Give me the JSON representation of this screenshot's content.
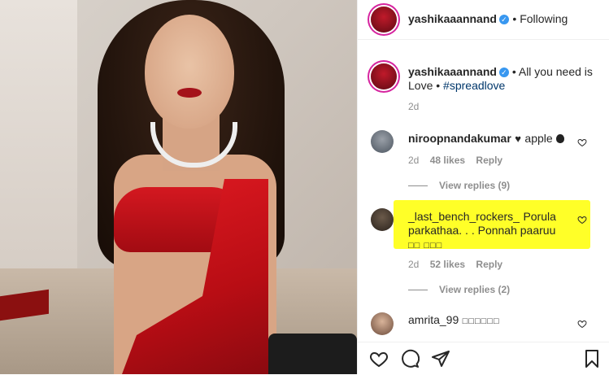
{
  "post": {
    "author": "yashikaaannand",
    "follow_status": "Following",
    "caption_text": "All you need is Love",
    "caption_hashtag": "#spreadlove",
    "caption_time": "2d"
  },
  "comments": [
    {
      "user": "niroopnandakumar",
      "text": "apple",
      "time": "2d",
      "likes": "48 likes",
      "reply": "Reply",
      "view_replies": "View replies (9)"
    },
    {
      "user": "_last_bench_rockers_",
      "text": "Porula parkathaa. . . Ponnah paaruu",
      "time": "2d",
      "likes": "52 likes",
      "reply": "Reply",
      "view_replies": "View replies (2)",
      "highlight_color": "#ffff28"
    },
    {
      "user": "amrita_99",
      "text": ""
    }
  ],
  "icons": {
    "verified": "verified-badge-icon",
    "like": "heart-outline-icon",
    "comment": "comment-bubble-icon",
    "share": "paper-plane-icon",
    "save": "bookmark-icon",
    "apple": "apple-emoji"
  },
  "colors": {
    "accent_link": "#00376b",
    "verified": "#3897f0",
    "highlight": "#ffff28",
    "saree_red": "#d41820"
  }
}
